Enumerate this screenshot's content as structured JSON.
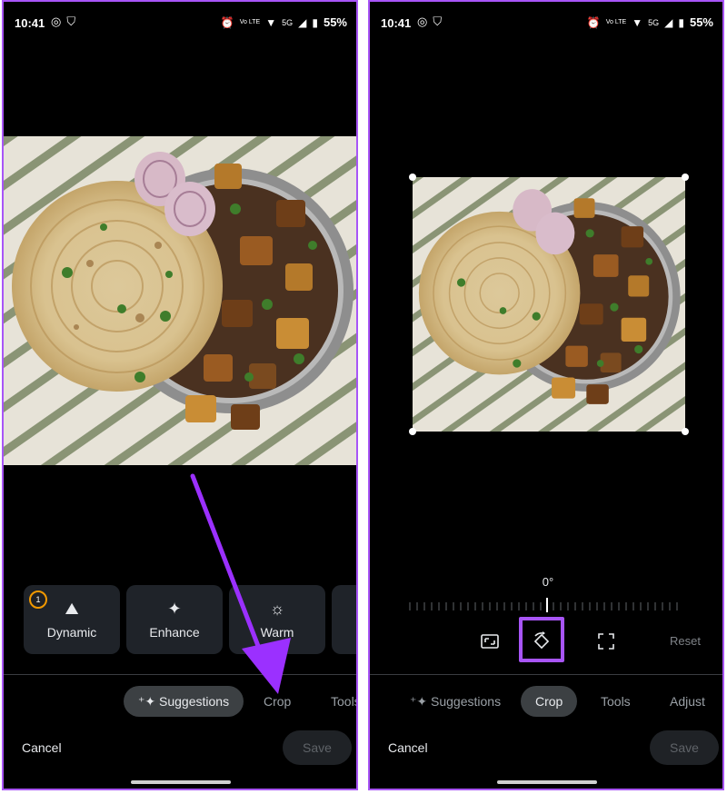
{
  "left_screen": {
    "status": {
      "time": "10:41",
      "battery": "55%",
      "network": "5G",
      "volte": "Vo LTE"
    },
    "edit_chips": [
      {
        "label": "Dynamic",
        "icon": "mountain-icon"
      },
      {
        "label": "Enhance",
        "icon": "sparkle-icon"
      },
      {
        "label": "Warm",
        "icon": "sun-icon"
      }
    ],
    "chip_badge": "1",
    "tabs": {
      "suggestions": "Suggestions",
      "crop": "Crop",
      "tools": "Tools"
    },
    "cancel": "Cancel",
    "save": "Save"
  },
  "right_screen": {
    "status": {
      "time": "10:41",
      "battery": "55%",
      "network": "5G",
      "volte": "Vo LTE"
    },
    "angle": "0°",
    "reset": "Reset",
    "tabs": {
      "suggestions": "Suggestions",
      "crop": "Crop",
      "tools": "Tools",
      "adjust": "Adjust"
    },
    "cancel": "Cancel",
    "save": "Save"
  },
  "colors": {
    "highlight": "#a855f7",
    "background": "#000000",
    "chip": "#1f2329"
  }
}
